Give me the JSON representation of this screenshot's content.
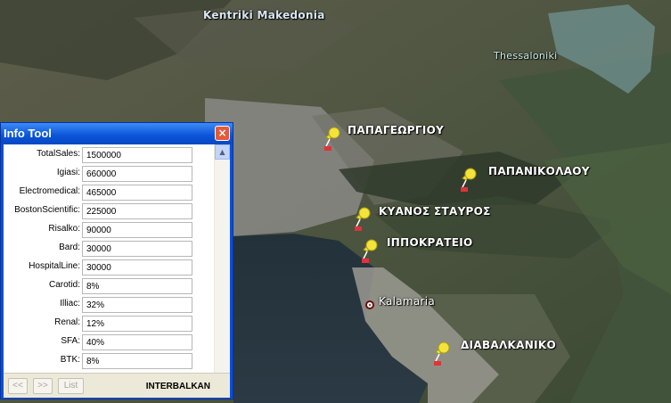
{
  "map": {
    "region_label": "Kentriki Makedonia",
    "city_label": "Thessaloniki",
    "places": [
      {
        "name": "ΠΑΠΑΓΕΩΡΓΙΟΥ"
      },
      {
        "name": "ΠΑΠΑΝΙΚΟΛΑΟΥ"
      },
      {
        "name": "ΚΥΑΝΟΣ ΣΤΑΥΡΟΣ"
      },
      {
        "name": "ΙΠΠΟΚΡΑΤΕΙΟ"
      },
      {
        "name": "Kalamaria"
      },
      {
        "name": "ΔΙΑΒΑΛΚΑΝΙΚΟ"
      }
    ],
    "pin_color": "#f3e33a"
  },
  "info_tool": {
    "title": "Info Tool",
    "close_label": "×",
    "fields": [
      {
        "name": "TotalSales:",
        "value": "1500000"
      },
      {
        "name": "Igiasi:",
        "value": "660000"
      },
      {
        "name": "Electromedical:",
        "value": "465000"
      },
      {
        "name": "BostonScientific:",
        "value": "225000"
      },
      {
        "name": "Risalko:",
        "value": "90000"
      },
      {
        "name": "Bard:",
        "value": "30000"
      },
      {
        "name": "HospitalLine:",
        "value": "30000"
      },
      {
        "name": "Carotid:",
        "value": "8%"
      },
      {
        "name": "Illiac:",
        "value": "32%"
      },
      {
        "name": "Renal:",
        "value": "12%"
      },
      {
        "name": "SFA:",
        "value": "40%"
      },
      {
        "name": "BTK:",
        "value": "8%"
      }
    ],
    "prev_label": "<<",
    "next_label": ">>",
    "list_label": "List",
    "company": "INTERBALKAN"
  }
}
